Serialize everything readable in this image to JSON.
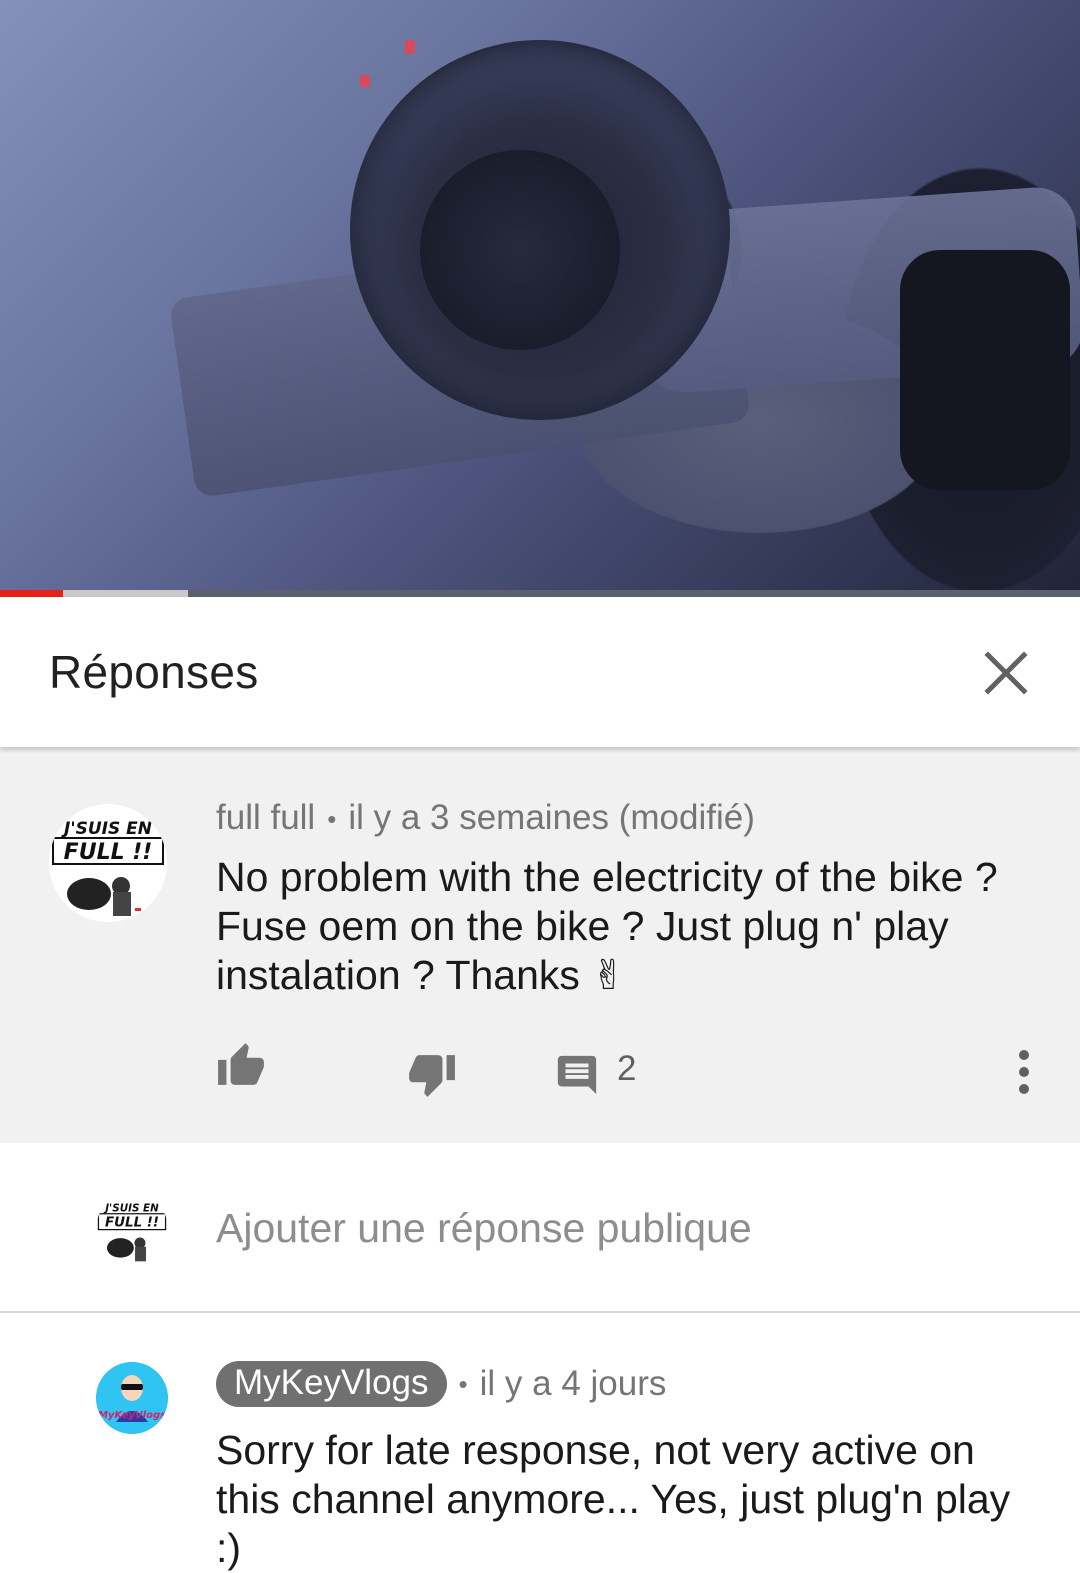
{
  "video": {
    "progress_played_pct": 5.8,
    "progress_buffered_pct": 17.4,
    "colors": {
      "played": "#e62117",
      "buffered": "#c8c8c8",
      "track": "#5b5f6e"
    }
  },
  "panel": {
    "title": "Réponses",
    "close_icon": "close-icon"
  },
  "parent_comment": {
    "avatar_icon": "channel-avatar-jsuis-en-full",
    "avatar_text_1": "J'SUIS EN",
    "avatar_text_2": "FULL !!",
    "author": "full full",
    "separator": "•",
    "time": "il y a 3 semaines (modifié)",
    "text": "No problem with the electricity of the bike ? Fuse oem on the bike ? Just plug n' play instalation ?  Thanks ✌",
    "like_icon": "thumb-up-icon",
    "dislike_icon": "thumb-down-icon",
    "reply_icon": "comment-icon",
    "reply_count": "2",
    "more_icon": "more-vert-icon"
  },
  "reply_box": {
    "avatar_icon": "channel-avatar-jsuis-en-full",
    "placeholder": "Ajouter une réponse publique"
  },
  "reply_comment": {
    "avatar_icon": "channel-avatar-mykeyvlogs",
    "avatar_text": "MyKeyVlogs",
    "author": "MyKeyVlogs",
    "separator": "•",
    "time": "il y a 4 jours",
    "text": "Sorry for late response, not very active on this channel anymore... Yes, just plug'n play :)"
  }
}
